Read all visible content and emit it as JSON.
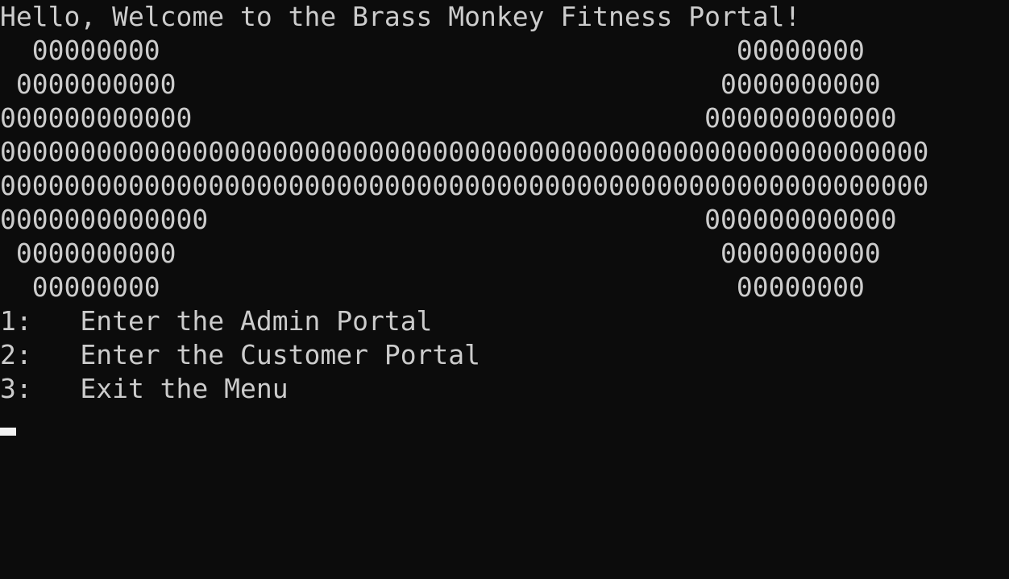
{
  "console": {
    "welcome": "Hello, Welcome to the Brass Monkey Fitness Portal!",
    "logo_lines": [
      "  00000000                                    00000000",
      " 0000000000                                  0000000000",
      "000000000000                                000000000000",
      "0000000000000000000000000000000000000000000000000000000000",
      "0000000000000000000000000000000000000000000000000000000000",
      "0000000000000                               000000000000",
      " 0000000000                                  0000000000",
      "  00000000                                    00000000"
    ],
    "menu": [
      "1:   Enter the Admin Portal",
      "2:   Enter the Customer Portal",
      "3:   Exit the Menu"
    ]
  },
  "colors": {
    "background": "#0c0c0c",
    "text": "#cccccc",
    "cursor": "#f2f2f2"
  }
}
